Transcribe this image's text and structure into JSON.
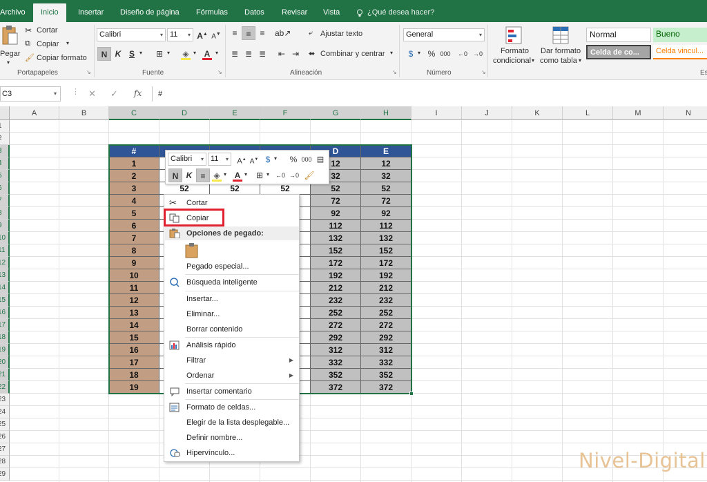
{
  "tabs": [
    "Archivo",
    "Inicio",
    "Insertar",
    "Diseño de página",
    "Fórmulas",
    "Datos",
    "Revisar",
    "Vista"
  ],
  "active_tab": "Inicio",
  "tell_me": "¿Qué desea hacer?",
  "ribbon": {
    "clipboard": {
      "paste": "Pegar",
      "cut": "Cortar",
      "copy": "Copiar",
      "format_painter": "Copiar formato",
      "group": "Portapapeles"
    },
    "font": {
      "name": "Calibri",
      "size": "11",
      "bold": "N",
      "italic": "K",
      "underline": "S",
      "group": "Fuente"
    },
    "alignment": {
      "wrap": "Ajustar texto",
      "merge": "Combinar y centrar",
      "group": "Alineación"
    },
    "number": {
      "format": "General",
      "group": "Número",
      "percent": "%",
      "thousands": "000"
    },
    "styles": {
      "cond_format_1": "Formato",
      "cond_format_2": "condicional",
      "as_table_1": "Dar formato",
      "as_table_2": "como tabla",
      "normal": "Normal",
      "good": "Bueno",
      "check_cell": "Celda de co...",
      "linked_cell": "Celda vincul...",
      "group_partial": "Es"
    }
  },
  "formula_bar": {
    "name_box": "C3",
    "cancel": "✕",
    "enter": "✓",
    "fx": "fx",
    "content": "#"
  },
  "columns": [
    "A",
    "B",
    "C",
    "D",
    "E",
    "F",
    "G",
    "H",
    "I",
    "J",
    "K",
    "L",
    "M",
    "N"
  ],
  "rows": [
    "1",
    "2",
    "3",
    "4",
    "5",
    "6",
    "7",
    "8",
    "9",
    "10",
    "11",
    "12",
    "13",
    "14",
    "15",
    "16",
    "17",
    "18",
    "19",
    "20",
    "21",
    "22",
    "23",
    "24",
    "25",
    "26",
    "27",
    "28",
    "29"
  ],
  "table": {
    "headers": [
      "#",
      "D",
      "E"
    ],
    "numbers": [
      "1",
      "2",
      "3",
      "4",
      "5",
      "6",
      "7",
      "8",
      "9",
      "10",
      "11",
      "12",
      "13",
      "14",
      "15",
      "16",
      "17",
      "18",
      "19"
    ],
    "col_d": [
      "12",
      "32",
      "52",
      "72",
      "92",
      "112",
      "132",
      "152",
      "172",
      "192",
      "212",
      "232",
      "252",
      "272",
      "292",
      "312",
      "332",
      "352",
      "372"
    ],
    "row3_vals": [
      "52",
      "52",
      "52"
    ]
  },
  "mini_toolbar": {
    "font": "Calibri",
    "size": "11",
    "bold": "N",
    "italic": "K",
    "percent": "%",
    "thousands": "000"
  },
  "context_menu": {
    "cut": "Cortar",
    "copy": "Copiar",
    "paste_options": "Opciones de pegado:",
    "paste_special": "Pegado especial...",
    "smart_lookup": "Búsqueda inteligente",
    "insert": "Insertar...",
    "delete": "Eliminar...",
    "clear": "Borrar contenido",
    "quick_analysis": "Análisis rápido",
    "filter": "Filtrar",
    "sort": "Ordenar",
    "insert_comment": "Insertar comentario",
    "format_cells": "Formato de celdas...",
    "pick_list": "Elegir de la lista desplegable...",
    "define_name": "Definir nombre...",
    "hyperlink": "Hipervínculo..."
  },
  "watermark": "Nivel-Digital"
}
